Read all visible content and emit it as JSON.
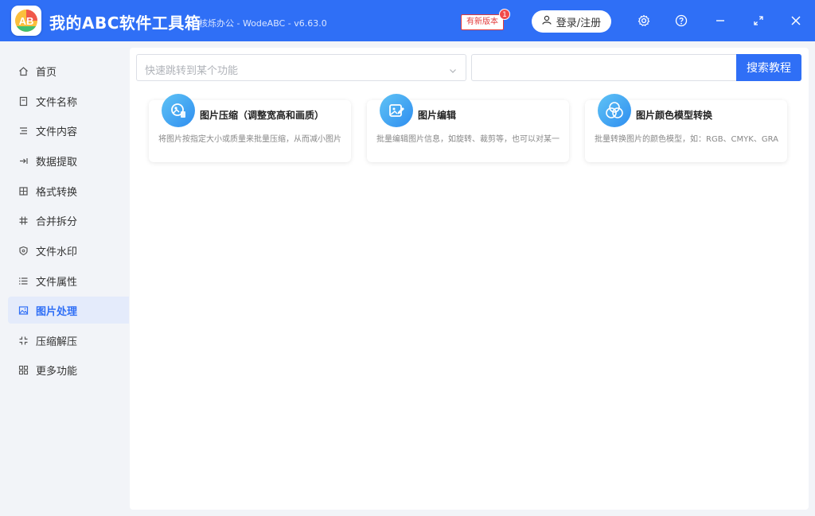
{
  "titlebar": {
    "app_name": "我的ABC软件工具箱",
    "subtitle": "核烁办公 - WodeABC - v6.63.0",
    "new_version_label": "有新版本",
    "new_version_count": "1",
    "login_label": "登录/注册",
    "icons": [
      "settings-icon",
      "help-icon",
      "minimize-icon",
      "maximize-icon",
      "close-icon"
    ]
  },
  "sidebar": {
    "items": [
      {
        "label": "首页",
        "icon": "home-icon"
      },
      {
        "label": "文件名称",
        "icon": "file-name-icon"
      },
      {
        "label": "文件内容",
        "icon": "file-content-icon"
      },
      {
        "label": "数据提取",
        "icon": "data-extract-icon"
      },
      {
        "label": "格式转换",
        "icon": "format-convert-icon"
      },
      {
        "label": "合并拆分",
        "icon": "merge-split-icon"
      },
      {
        "label": "文件水印",
        "icon": "watermark-icon"
      },
      {
        "label": "文件属性",
        "icon": "properties-icon"
      },
      {
        "label": "图片处理",
        "icon": "image-icon",
        "active": true
      },
      {
        "label": "压缩解压",
        "icon": "compress-icon"
      },
      {
        "label": "更多功能",
        "icon": "more-icon"
      }
    ]
  },
  "main": {
    "jump_placeholder": "快速跳转到某个功能",
    "search_value": "",
    "search_button": "搜索教程",
    "cards": [
      {
        "title": "图片压缩（调整宽高和画质）",
        "desc": "将图片按指定大小或质量来批量压缩，从而减小图片",
        "icon": "image-compress-icon"
      },
      {
        "title": "图片编辑",
        "desc": "批量编辑图片信息，如旋转、裁剪等，也可以对某一",
        "icon": "image-edit-icon"
      },
      {
        "title": "图片颜色模型转换",
        "desc": "批量转换图片的颜色模型，如：RGB、CMYK、GRA",
        "icon": "color-model-icon"
      }
    ]
  },
  "colors": {
    "brand_blue": "#2f6ff6",
    "alert_red": "#e23b3b"
  }
}
